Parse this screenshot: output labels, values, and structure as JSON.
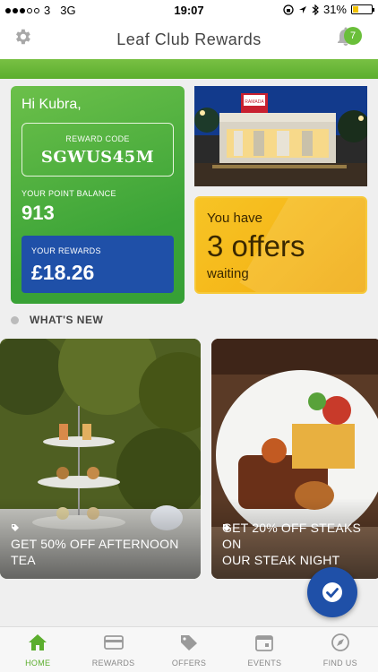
{
  "status_bar": {
    "carrier": "3",
    "network": "3G",
    "time": "19:07",
    "battery_percent": "31%"
  },
  "header": {
    "title": "Leaf Club Rewards",
    "notification_count": "7"
  },
  "reward_card": {
    "greeting": "Hi Kubra,",
    "reward_code_label": "REWARD CODE",
    "reward_code": "SGWUS45M",
    "point_balance_label": "YOUR POINT BALANCE",
    "point_balance": "913",
    "rewards_label": "YOUR REWARDS",
    "rewards_value": "£18.26"
  },
  "hotel_photo": {
    "sign_text": "RAMADA"
  },
  "offers": {
    "line1": "You have",
    "line2": "3 offers",
    "line3": "waiting"
  },
  "whats_new": {
    "title": "WHAT'S NEW",
    "items": [
      {
        "caption_line1": "GET 50% OFF AFTERNOON",
        "caption_line2": "TEA"
      },
      {
        "caption_line1": "GET 20% OFF STEAKS ON",
        "caption_line2": "OUR STEAK NIGHT"
      }
    ]
  },
  "tabs": [
    {
      "label": "HOME",
      "icon": "home-icon",
      "active": true
    },
    {
      "label": "REWARDS",
      "icon": "card-icon",
      "active": false
    },
    {
      "label": "OFFERS",
      "icon": "tag-icon",
      "active": false
    },
    {
      "label": "EVENTS",
      "icon": "calendar-icon",
      "active": false
    },
    {
      "label": "FIND US",
      "icon": "compass-icon",
      "active": false
    }
  ],
  "colors": {
    "brand_green": "#5cae2e",
    "rewards_blue": "#1f50a8",
    "offers_yellow": "#f5b81a"
  }
}
